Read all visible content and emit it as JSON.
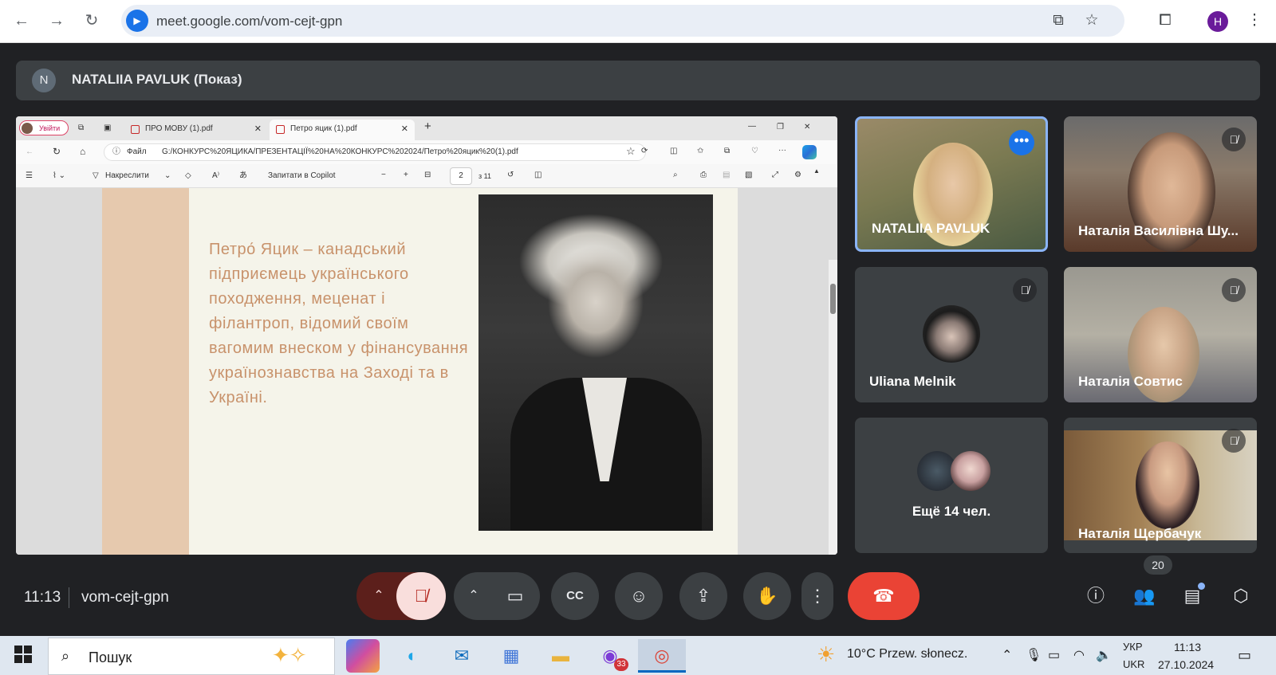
{
  "browser": {
    "url": "meet.google.com/vom-cejt-gpn",
    "profile_initial": "H"
  },
  "presenter": {
    "initial": "N",
    "label": "NATALIIA PAVLUK (Показ)"
  },
  "shared": {
    "edge_profile_label": "Увійти",
    "tabs": [
      {
        "label": "ПРО МОВУ (1).pdf"
      },
      {
        "label": "Петро яцик (1).pdf"
      }
    ],
    "file_label": "Файл",
    "path": "G:/КОНКУРС%20ЯЦИКА/ПРЕЗЕНТАЦІЇ%20НА%20КОНКУРС%202024/Петро%20яцик%20(1).pdf",
    "draw_label": "Накреслити",
    "copilot_label": "Запитати в Copilot",
    "page_number": "2",
    "page_total": "з 11",
    "slide_text": "Петро́ Яцик – канадський підприємець українського походження, меценат і філантроп, відомий своїм вагомим внеском у фінансування українознавства на Заході та в Україні."
  },
  "participants": [
    {
      "name": "NATALIIA PAVLUK"
    },
    {
      "name": "Наталія Василівна Шу..."
    },
    {
      "name": "Uliana Melnik"
    },
    {
      "name": "Наталія Совтис"
    },
    {
      "name": "Ещё 14 чел."
    },
    {
      "name": "Наталія Щербачук"
    }
  ],
  "controls": {
    "time": "11:13",
    "meeting_code": "vom-cejt-gpn",
    "people_count": "20"
  },
  "taskbar": {
    "search_label": "Пошук",
    "badge": "33",
    "weather": "10°C  Przew. słonecz.",
    "lang_top": "УКР",
    "lang_bottom": "UKR",
    "clock_time": "11:13",
    "clock_date": "27.10.2024"
  },
  "colors": {
    "meet_bg": "#202124",
    "tile_bg": "#3c4043",
    "accent": "#1a73e8",
    "hangup": "#ea4335",
    "mic_muted_bg": "#f9dedc",
    "slide_text": "#c8926b",
    "slide_bar": "#e6c9ae"
  }
}
